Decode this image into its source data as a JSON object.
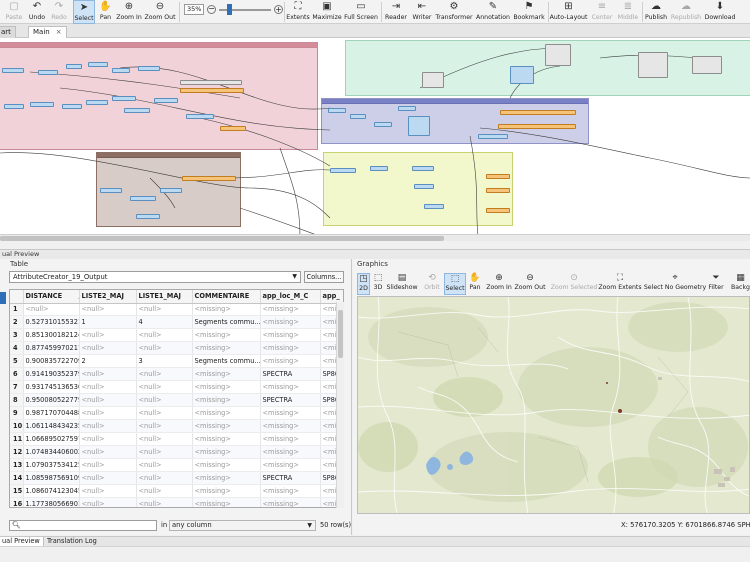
{
  "toolbar": {
    "paste": "Paste",
    "undo": "Undo",
    "redo": "Redo",
    "select": "Select",
    "pan": "Pan",
    "zoom_in": "Zoom In",
    "zoom_out": "Zoom Out",
    "zoom_value": "35%",
    "extents": "Extents",
    "maximize": "Maximize",
    "full_screen": "Full Screen",
    "reader": "Reader",
    "writer": "Writer",
    "transformer": "Transformer",
    "annotation": "Annotation",
    "bookmark": "Bookmark",
    "auto_layout": "Auto-Layout",
    "center": "Center",
    "middle": "Middle",
    "publish": "Publish",
    "republish": "Republish",
    "download": "Download"
  },
  "canvas_tabs": [
    {
      "label": "art"
    },
    {
      "label": "Main",
      "close": "×"
    }
  ],
  "visual_preview": {
    "title": "ual Preview",
    "table_title": "Table",
    "graphics_title": "Graphics",
    "dataset": "AttributeCreator_19_Output",
    "columns_button": "Columns...",
    "columns": [
      "DISTANCE",
      "LISTE2_MAJ",
      "LISTE1_MAJ",
      "COMMENTAIRE",
      "app_loc_M_C",
      "app_"
    ],
    "sort_marker": "▲",
    "rows": [
      {
        "n": "1",
        "cells": [
          "<null>",
          "<null>",
          "<null>",
          "<missing>",
          "<missing>",
          "<mis"
        ]
      },
      {
        "n": "2",
        "cells": [
          "0.527310155321...",
          "1",
          "4",
          "Segments commu...",
          "<missing>",
          "<mis"
        ]
      },
      {
        "n": "3",
        "cells": [
          "0.851300182124...",
          "<null>",
          "<null>",
          "<missing>",
          "<missing>",
          "<mis"
        ]
      },
      {
        "n": "4",
        "cells": [
          "0.877459970217...",
          "<null>",
          "<null>",
          "<missing>",
          "<missing>",
          "<mis"
        ]
      },
      {
        "n": "5",
        "cells": [
          "0.900835722709...",
          "2",
          "3",
          "Segments commu...",
          "<missing>",
          "<mis"
        ]
      },
      {
        "n": "6",
        "cells": [
          "0.914190352379...",
          "<null>",
          "<null>",
          "<missing>",
          "SPECTRA",
          "SP80"
        ]
      },
      {
        "n": "7",
        "cells": [
          "0.931745136530...",
          "<null>",
          "<null>",
          "<missing>",
          "<missing>",
          "<mis"
        ]
      },
      {
        "n": "8",
        "cells": [
          "0.950080522779...",
          "<null>",
          "<null>",
          "<missing>",
          "SPECTRA",
          "SP80"
        ]
      },
      {
        "n": "9",
        "cells": [
          "0.987170704488...",
          "<null>",
          "<null>",
          "<missing>",
          "<missing>",
          "<mis"
        ]
      },
      {
        "n": "10",
        "cells": [
          "1.061148434235...",
          "<null>",
          "<null>",
          "<missing>",
          "<missing>",
          "<mis"
        ]
      },
      {
        "n": "11",
        "cells": [
          "1.066895027597...",
          "<null>",
          "<null>",
          "<missing>",
          "<missing>",
          "<mis"
        ]
      },
      {
        "n": "12",
        "cells": [
          "1.074834406002...",
          "<null>",
          "<null>",
          "<missing>",
          "<missing>",
          "<mis"
        ]
      },
      {
        "n": "13",
        "cells": [
          "1.079037534125...",
          "<null>",
          "<null>",
          "<missing>",
          "<missing>",
          "<mis"
        ]
      },
      {
        "n": "14",
        "cells": [
          "1.085987569109...",
          "<null>",
          "<null>",
          "<missing>",
          "SPECTRA",
          "SP80"
        ]
      },
      {
        "n": "15",
        "cells": [
          "1.086074123045...",
          "<null>",
          "<null>",
          "<missing>",
          "<missing>",
          "<mis"
        ]
      },
      {
        "n": "16",
        "cells": [
          "1.177380566901...",
          "<null>",
          "<null>",
          "<missing>",
          "<missing>",
          "<mis"
        ]
      }
    ],
    "search_placeholder": "",
    "in_label": "in",
    "column_filter": "any column",
    "row_count": "50 row(s)",
    "graphics_tools": {
      "view_2d": "2D",
      "view_3d": "3D",
      "slideshow": "Slideshow",
      "orbit": "Orbit",
      "select": "Select",
      "pan": "Pan",
      "zoom_in": "Zoom In",
      "zoom_out": "Zoom Out",
      "zoom_selected": "Zoom Selected",
      "zoom_extents": "Zoom Extents",
      "select_no_geometry": "Select No Geometry",
      "filter": "Filter",
      "background": "Backg"
    },
    "coords": "X:   576170.3205   Y:   6701866.8746   SPHERI"
  },
  "bottom_tabs": {
    "visual_preview": "ual Preview",
    "translation_log": "Translation Log"
  },
  "colors": {
    "accent": "#2f6fb8",
    "bookmark_red": "#f0d2d8",
    "bookmark_green": "#d8f3e6",
    "bookmark_purple": "#cdcfe9",
    "bookmark_yellow": "#f3f7cc",
    "bookmark_brown": "#d8ccc8",
    "map_land": "#e4e8cf",
    "map_water": "#8fb6de"
  }
}
